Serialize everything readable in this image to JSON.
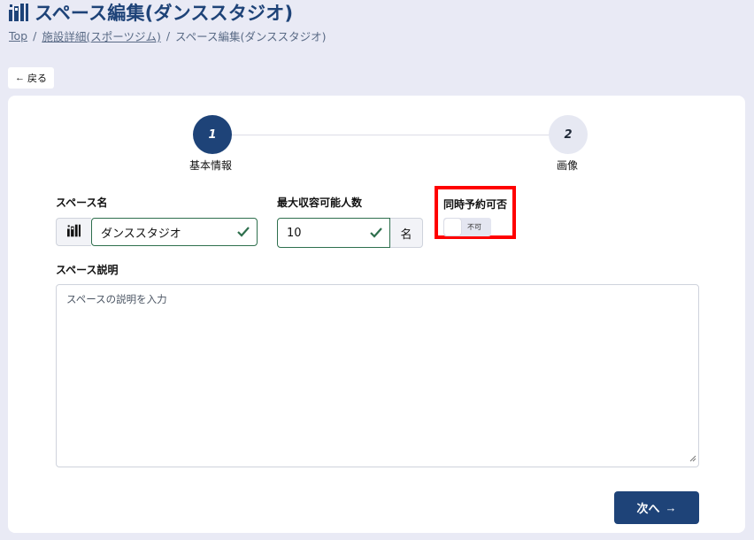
{
  "header": {
    "title": "スペース編集(ダンススタジオ)",
    "icon": "building-icon"
  },
  "breadcrumb": {
    "items": [
      "Top",
      "施設詳細(スポーツジム)",
      "スペース編集(ダンススタジオ)"
    ],
    "separator": "/"
  },
  "back_button": {
    "arrow": "←",
    "label": "戻る"
  },
  "stepper": {
    "steps": [
      {
        "number": "1",
        "label": "基本情報",
        "active": true
      },
      {
        "number": "2",
        "label": "画像",
        "active": false
      }
    ]
  },
  "form": {
    "space_name": {
      "label": "スペース名",
      "value": "ダンススタジオ",
      "valid": true
    },
    "capacity": {
      "label": "最大収容可能人数",
      "value": "10",
      "unit": "名",
      "valid": true
    },
    "concurrent": {
      "label": "同時予約可否",
      "toggle_text": "不可",
      "checked": false
    },
    "description": {
      "label": "スペース説明",
      "placeholder": "スペースの説明を入力"
    }
  },
  "next_button": {
    "label": "次へ",
    "arrow": "→"
  },
  "colors": {
    "primary": "#1e4378",
    "valid": "#2e6f4d",
    "highlight": "#ff0000",
    "background": "#e9eaf5"
  }
}
